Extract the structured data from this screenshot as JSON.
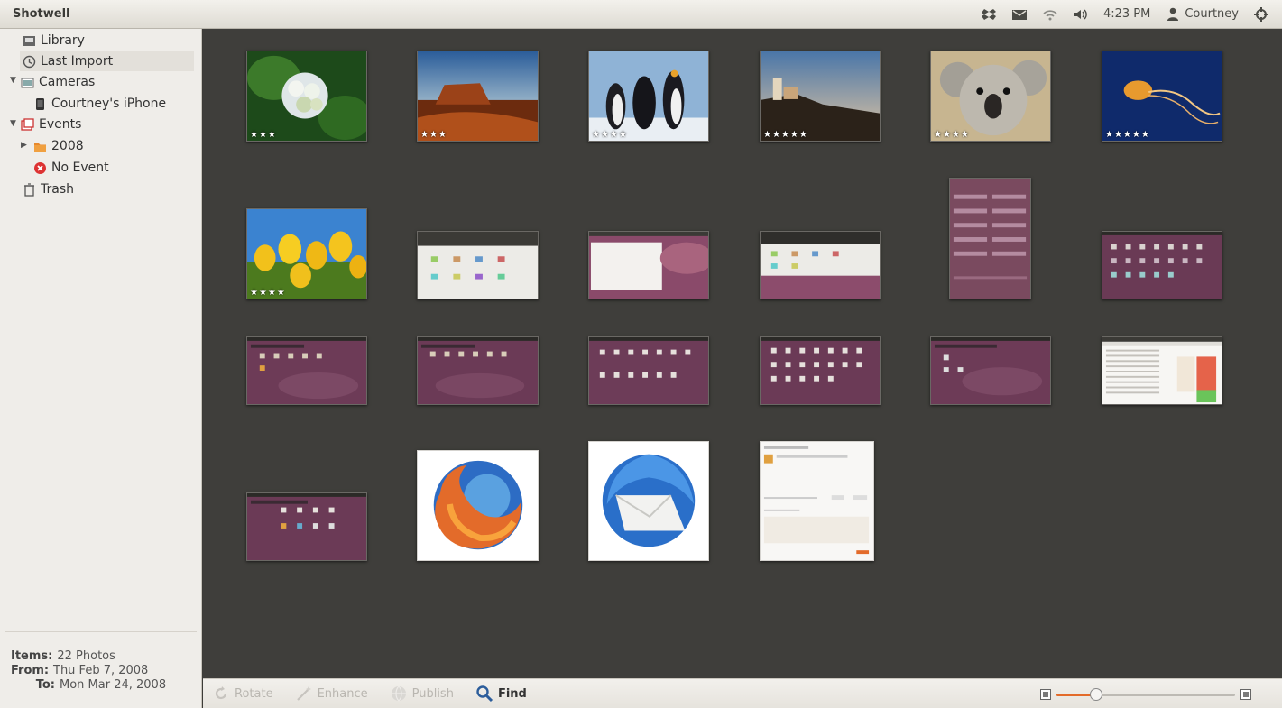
{
  "app": {
    "title": "Shotwell"
  },
  "tray": {
    "time": "4:23 PM",
    "user": "Courtney"
  },
  "sidebar": {
    "library": "Library",
    "last_import": "Last Import",
    "cameras": "Cameras",
    "iphone": "Courtney's iPhone",
    "events": "Events",
    "year": "2008",
    "no_event": "No Event",
    "trash": "Trash"
  },
  "stats": {
    "items_label": "Items:",
    "items_value": "22 Photos",
    "from_label": "From:",
    "from_value": "Thu Feb 7, 2008",
    "to_label": "To:",
    "to_value": "Mon Mar 24, 2008"
  },
  "toolbar": {
    "rotate": "Rotate",
    "enhance": "Enhance",
    "publish": "Publish",
    "find": "Find",
    "zoom_level": 0.22
  },
  "photos": [
    {
      "kind": "hydrangea",
      "stars": "★★★"
    },
    {
      "kind": "desert",
      "stars": "★★★"
    },
    {
      "kind": "penguins",
      "stars": "★★★★"
    },
    {
      "kind": "lighthouse",
      "stars": "★★★★★"
    },
    {
      "kind": "koala",
      "stars": "★★★★"
    },
    {
      "kind": "jellyfish",
      "stars": "★★★★★"
    },
    {
      "kind": "tulips",
      "stars": "★★★★"
    },
    {
      "kind": "screen-light",
      "stars": ""
    },
    {
      "kind": "screen-window",
      "stars": ""
    },
    {
      "kind": "screen-light-2",
      "stars": ""
    },
    {
      "kind": "screen-tall",
      "stars": ""
    },
    {
      "kind": "screen-icons",
      "stars": ""
    },
    {
      "kind": "screen-dark-1",
      "stars": ""
    },
    {
      "kind": "screen-dark-2",
      "stars": ""
    },
    {
      "kind": "screen-icons-2",
      "stars": ""
    },
    {
      "kind": "screen-icons-3",
      "stars": ""
    },
    {
      "kind": "screen-dark-3",
      "stars": ""
    },
    {
      "kind": "screen-spreadsheet",
      "stars": ""
    },
    {
      "kind": "screen-dark-4",
      "stars": ""
    },
    {
      "kind": "firefox-logo",
      "stars": ""
    },
    {
      "kind": "thunderbird-logo",
      "stars": ""
    },
    {
      "kind": "screen-dialog",
      "stars": ""
    }
  ],
  "colors": {
    "accent": "#e36b2a",
    "viewer_bg": "#3f3e3b",
    "panel_bg": "#efede9"
  }
}
